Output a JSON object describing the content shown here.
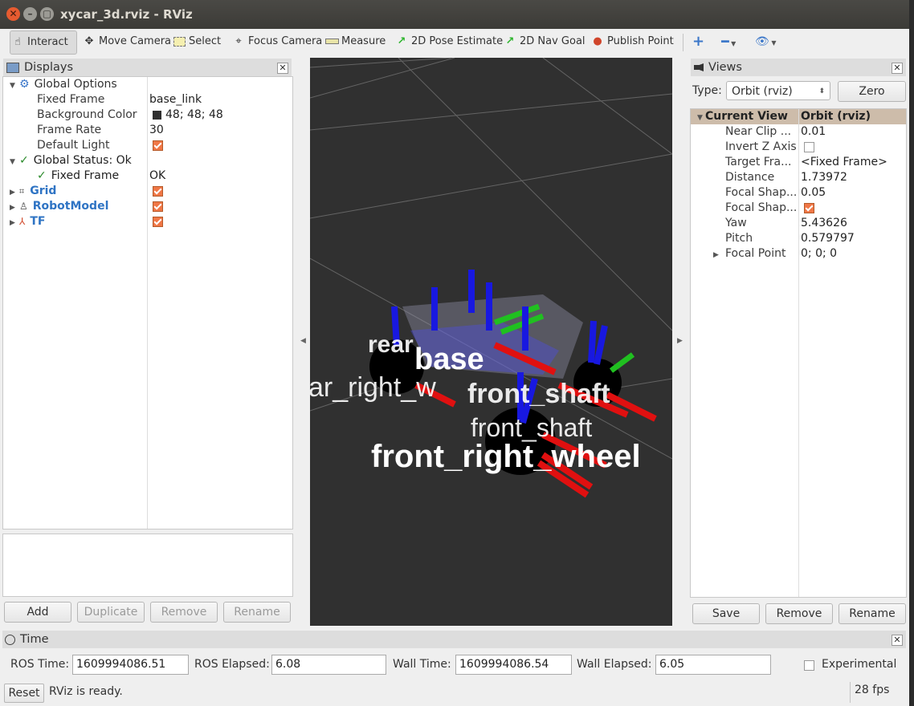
{
  "window": {
    "title": "xycar_3d.rviz - RViz"
  },
  "toolbar": {
    "interact": "Interact",
    "move_camera": "Move Camera",
    "select": "Select",
    "focus_camera": "Focus Camera",
    "measure": "Measure",
    "pose_estimate": "2D Pose Estimate",
    "nav_goal": "2D Nav Goal",
    "publish_point": "Publish Point"
  },
  "displays": {
    "title": "Displays",
    "rows": [
      {
        "label": "Global Options",
        "value": ""
      },
      {
        "label": "Fixed Frame",
        "value": "base_link"
      },
      {
        "label": "Background Color",
        "value": "48; 48; 48"
      },
      {
        "label": "Frame Rate",
        "value": "30"
      },
      {
        "label": "Default Light",
        "value": ""
      },
      {
        "label": "Global Status: Ok",
        "value": ""
      },
      {
        "label": "Fixed Frame",
        "value": "OK"
      },
      {
        "label": "Grid",
        "value": ""
      },
      {
        "label": "RobotModel",
        "value": ""
      },
      {
        "label": "TF",
        "value": ""
      }
    ],
    "buttons": {
      "add": "Add",
      "duplicate": "Duplicate",
      "remove": "Remove",
      "rename": "Rename"
    }
  },
  "viewport": {
    "labels": [
      "base",
      "front_right_wheel",
      "front_shaft",
      "rear",
      "ar_right_w"
    ],
    "background": "#303030"
  },
  "views": {
    "title": "Views",
    "type_label": "Type:",
    "type_value": "Orbit (rviz)",
    "zero": "Zero",
    "header": {
      "label": "Current View",
      "value": "Orbit (rviz)"
    },
    "rows": [
      {
        "label": "Near Clip ...",
        "value": "0.01"
      },
      {
        "label": "Invert Z Axis",
        "value": ""
      },
      {
        "label": "Target Fra...",
        "value": "<Fixed Frame>"
      },
      {
        "label": "Distance",
        "value": "1.73972"
      },
      {
        "label": "Focal Shap...",
        "value": "0.05"
      },
      {
        "label": "Focal Shap...",
        "value": ""
      },
      {
        "label": "Yaw",
        "value": "5.43626"
      },
      {
        "label": "Pitch",
        "value": "0.579797"
      },
      {
        "label": "Focal Point",
        "value": "0; 0; 0"
      }
    ],
    "buttons": {
      "save": "Save",
      "remove": "Remove",
      "rename": "Rename"
    }
  },
  "time": {
    "title": "Time",
    "ros_time_label": "ROS Time:",
    "ros_time": "1609994086.51",
    "ros_elapsed_label": "ROS Elapsed:",
    "ros_elapsed": "6.08",
    "wall_time_label": "Wall Time:",
    "wall_time": "1609994086.54",
    "wall_elapsed_label": "Wall Elapsed:",
    "wall_elapsed": "6.05",
    "experimental": "Experimental"
  },
  "status": {
    "reset": "Reset",
    "message": "RViz is ready.",
    "fps": "28 fps"
  }
}
